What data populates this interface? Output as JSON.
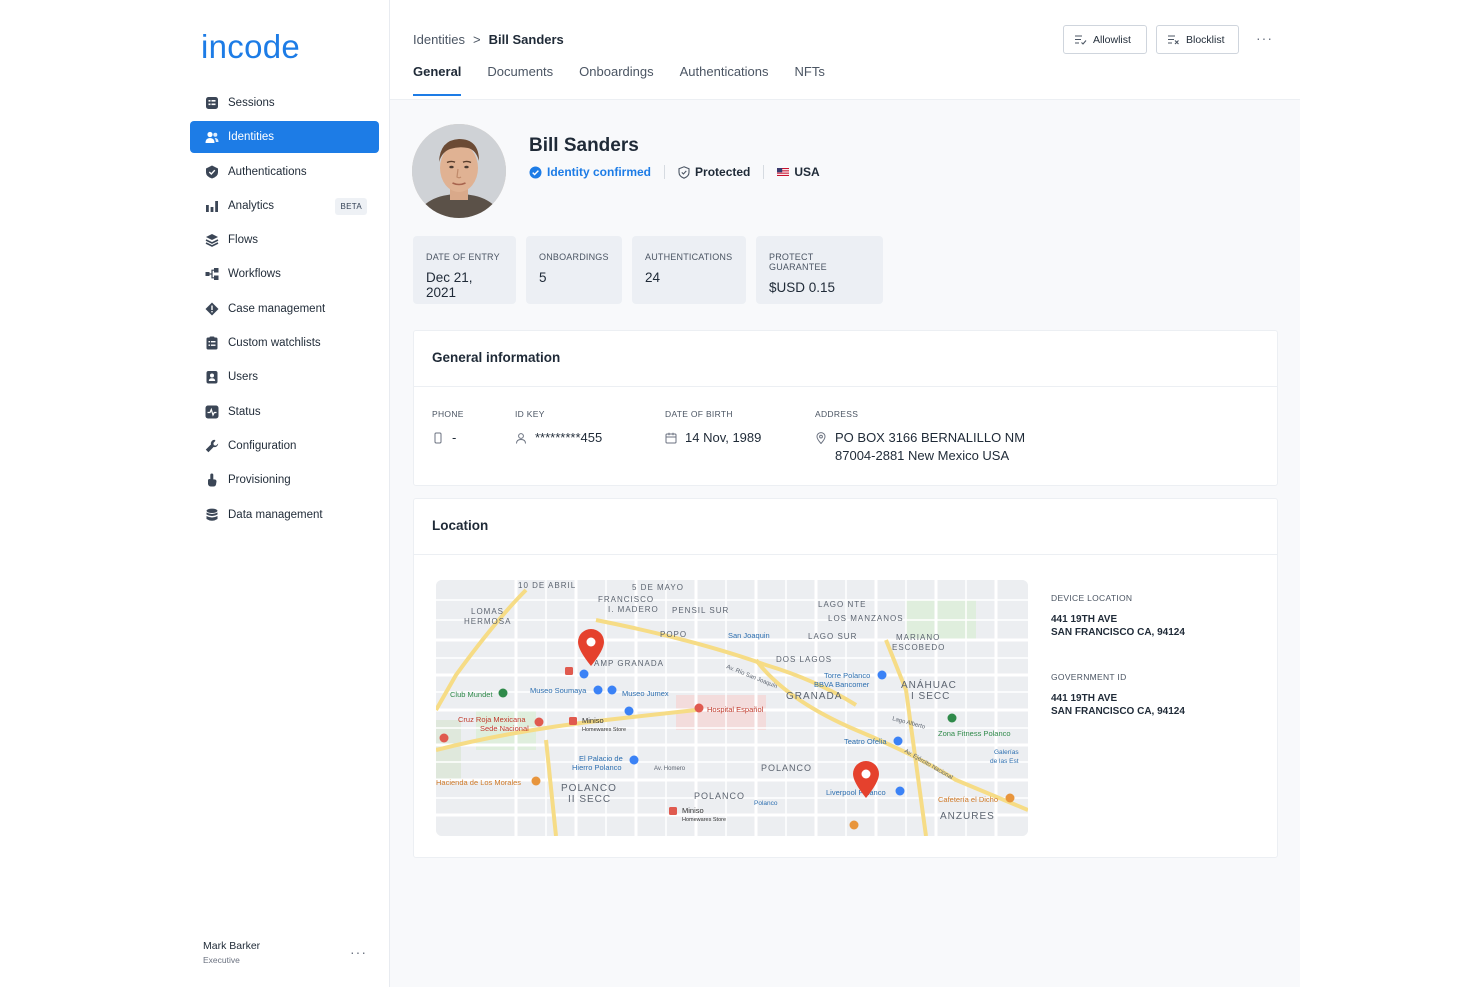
{
  "brand": {
    "logo": "incode",
    "color": "#1d7ce6"
  },
  "sidebar": {
    "items": [
      {
        "label": "Sessions",
        "icon": "sessions-icon"
      },
      {
        "label": "Identities",
        "icon": "identities-icon",
        "active": true
      },
      {
        "label": "Authentications",
        "icon": "authentications-icon"
      },
      {
        "label": "Analytics",
        "icon": "analytics-icon",
        "badge": "BETA"
      },
      {
        "label": "Flows",
        "icon": "flows-icon"
      },
      {
        "label": "Workflows",
        "icon": "workflows-icon"
      },
      {
        "label": "Case management",
        "icon": "case-management-icon"
      },
      {
        "label": "Custom watchlists",
        "icon": "custom-watchlists-icon"
      },
      {
        "label": "Users",
        "icon": "users-icon"
      },
      {
        "label": "Status",
        "icon": "status-icon"
      },
      {
        "label": "Configuration",
        "icon": "configuration-icon"
      },
      {
        "label": "Provisioning",
        "icon": "provisioning-icon"
      },
      {
        "label": "Data management",
        "icon": "data-management-icon"
      }
    ],
    "user": {
      "name": "Mark Barker",
      "role": "Executive",
      "more": "···"
    }
  },
  "header": {
    "breadcrumb": {
      "parent": "Identities",
      "separator": ">",
      "current": "Bill Sanders"
    },
    "tabs": [
      "General",
      "Documents",
      "Onboardings",
      "Authentications",
      "NFTs"
    ],
    "active_tab": "General",
    "allowlist_label": "Allowlist",
    "blocklist_label": "Blocklist",
    "more": "···"
  },
  "profile": {
    "name": "Bill Sanders",
    "status": "Identity confirmed",
    "protection": "Protected",
    "country": "USA"
  },
  "stats": [
    {
      "label": "DATE OF ENTRY",
      "value": "Dec 21, 2021"
    },
    {
      "label": "ONBOARDINGS",
      "value": "5"
    },
    {
      "label": "AUTHENTICATIONS",
      "value": "24"
    },
    {
      "label": "PROTECT GUARANTEE",
      "value": "$USD 0.15"
    }
  ],
  "general_info": {
    "title": "General information",
    "phone": {
      "label": "PHONE",
      "value": "-"
    },
    "id_key": {
      "label": "ID KEY",
      "value": "*********455"
    },
    "dob": {
      "label": "DATE OF BIRTH",
      "value": "14 Nov, 1989"
    },
    "address": {
      "label": "ADDRESS",
      "line1": "PO BOX 3166 BERNALILLO NM",
      "line2": "87004-2881 New Mexico USA"
    }
  },
  "location": {
    "title": "Location",
    "device": {
      "label": "DEVICE LOCATION",
      "line1": "441 19TH AVE",
      "line2": "SAN FRANCISCO CA, 94124"
    },
    "government": {
      "label": "GOVERNMENT ID",
      "line1": "441 19TH AVE",
      "line2": "SAN FRANCISCO CA, 94124"
    },
    "map_labels": {
      "a1": "LOMAS",
      "a2": "HERMOSA",
      "b": "10 DE ABRIL",
      "c": "5 DE MAYO",
      "d1": "FRANCISCO",
      "d2": "I. MADERO",
      "e": "PENSIL SUR",
      "f": "LAGO NTE",
      "g": "LOS MANZANOS",
      "h": "POPO",
      "i": "LAGO SUR",
      "j1": "MARIANO",
      "j2": "ESCOBEDO",
      "k": "DOS LAGOS",
      "l": "AMP GRANADA",
      "m": "GRANADA",
      "n1": "ANÁHUAC",
      "n2": "I SECC",
      "o": "Club Mundet",
      "p": "Museo Soumaya",
      "q": "Museo Jumex",
      "r": "Hospital Español",
      "s1": "Cruz Roja Mexicana",
      "s2": "Sede Nacional",
      "t1": "Miniso",
      "t2": "Homewares Store",
      "u": "Teatro Ofelia",
      "v": "Zona Fitness Polanco",
      "w1": "El Palacio de",
      "w2": "Hierro Polanco",
      "x": "POLANCO",
      "y1": "POLANCO",
      "y2": "II SECC",
      "z": "Hacienda de Los Morales",
      "aa": "Liverpool Polanco",
      "ab": "Cafetería el Dicho",
      "ac": "ANZURES",
      "ad": "San Joaquin",
      "ae": "Torre Polanco",
      "af": "BBVA Bancomer",
      "ag1": "Miniso",
      "ag2": "Homewares Store",
      "ah": "POLANCO",
      "ai": "Av. Homero",
      "aj": "Av. Río San Joaquín",
      "ak": "Galerías",
      "ak2": "de las Est",
      "al": "Av. Ejército Nacional",
      "am": "Lago Alberto",
      "an": "Polanco"
    }
  },
  "colors": {
    "accent": "#1d7ce6",
    "pin": "#e5412d"
  }
}
